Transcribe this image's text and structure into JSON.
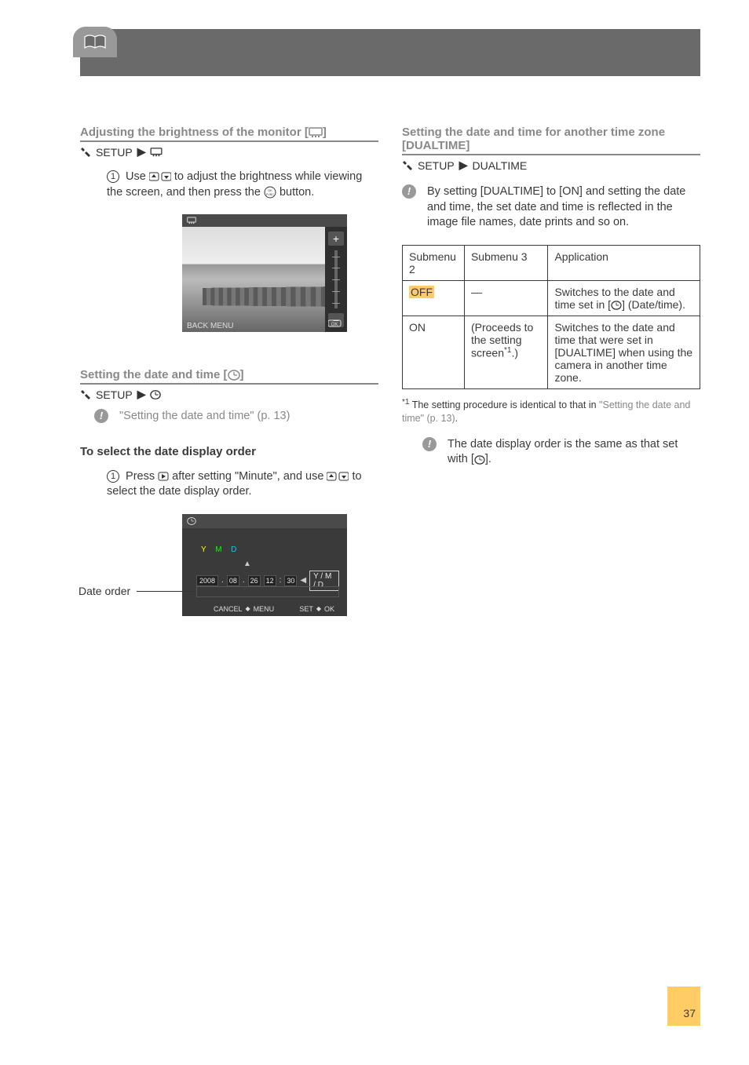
{
  "page_number": "37",
  "sections": {
    "brightness": {
      "heading_pre": "Adjusting the brightness of the monitor [",
      "heading_post": "]",
      "breadcrumb_setup": "SETUP",
      "step1_part_a": "Use ",
      "step1_part_b": " to adjust the brightness while viewing the screen, and then press the ",
      "step1_part_c": " button.",
      "preview": {
        "back": "BACK",
        "ok_label": "MENU",
        "plus": "+",
        "minus": "−"
      }
    },
    "datetime": {
      "heading_pre": "Setting the date and time [",
      "heading_post": "]",
      "breadcrumb_setup": "SETUP",
      "note_ref_pre": " \"Setting the date and time\" (p. 13)",
      "sub_heading": "To select the date display order",
      "step1_a": "Press ",
      "step1_b": " after setting \"Minute\", and use ",
      "step1_c": " to select the date display order.",
      "date_order_label": "Date order",
      "preview": {
        "top_icon_label": "",
        "Y": "Y",
        "M": "M",
        "D": "D",
        "year": "2008",
        "mon": "08",
        "day": "26",
        "hour": "12",
        "min": "30",
        "order": "Y / M / D",
        "cancel": "CANCEL",
        "cancel_btn": "MENU",
        "set": "SET",
        "set_btn": "OK"
      }
    },
    "dualtime": {
      "heading": "Setting the date and time for another time zone [DUALTIME]",
      "breadcrumb_setup": "SETUP",
      "breadcrumb_item": "DUALTIME",
      "note_text": "By setting [DUALTIME] to [ON] and setting the date and time, the set date and time is reflected in the image file names, date prints and so on.",
      "table": {
        "hdr_submenu2": "Submenu 2",
        "hdr_submenu3": "Submenu 3",
        "hdr_app": "Application",
        "rows": [
          {
            "c1": "OFF",
            "c2": "—",
            "c3_a": "Switches to the date and time set in [",
            "c3_b": "] (Date/time)."
          },
          {
            "c1": "ON",
            "c2_a": "(Proceeds to the setting screen",
            "c2_sup": "*1",
            "c2_b": ".)",
            "c3": "Switches to the date and time that were set in [DUALTIME] when using the camera in another time zone."
          }
        ]
      },
      "footnote_a": " The setting procedure is identical to that in ",
      "footnote_b": "\"Setting the date and time\" (p. 13)",
      "footnote_sup": "*1",
      "note2_a": "The date display order is the same as that set with [",
      "note2_b": "]."
    }
  }
}
